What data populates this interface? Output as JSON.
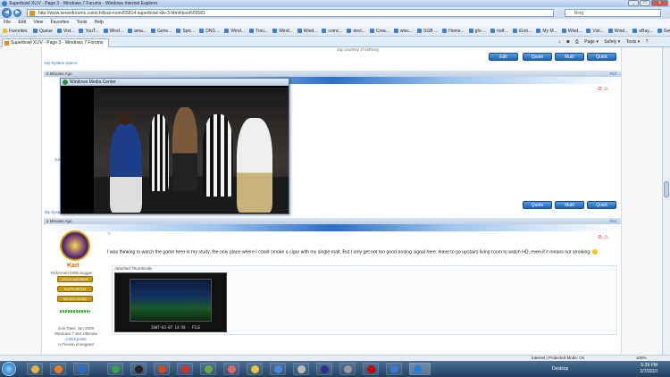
{
  "window": {
    "title": "Superbowl XLIV - Page 3 - Windows 7 Forums - Windows Internet Explorer"
  },
  "address": {
    "url": "http://www.sevenforums.com/chillout-room/55814-superbowl-xliv-3.html#post555581",
    "search_placeholder": "Bing"
  },
  "menu": [
    "File",
    "Edit",
    "View",
    "Favorites",
    "Tools",
    "Help"
  ],
  "favorites": {
    "label": "Favorites",
    "items": [
      "Queue",
      "Vist...",
      "YouT...",
      "Wind...",
      "ama...",
      "Gene...",
      "Spic...",
      "DNS ...",
      "Wind...",
      "Trou...",
      "Wind...",
      "Wind...",
      "comc...",
      "devi...",
      "Crea...",
      "winc...",
      "SGB ...",
      "Home...",
      "gfx-...",
      "netf...",
      "iGoo...",
      "My M...",
      "Wind...",
      "Vist...",
      "Wind...",
      "eBay...",
      "Get ..."
    ]
  },
  "tab": {
    "label": "Superbowl XLIV - Page 3 - Windows 7 Forums"
  },
  "commands": [
    "Page ▾",
    "Safety ▾",
    "Tools ▾"
  ],
  "post_top": {
    "signature": "Sig courtesy of Anthony",
    "specs_link": "My System Specs",
    "buttons": [
      "Edit",
      "Quote",
      "Multi",
      "Quick"
    ]
  },
  "post23": {
    "time": "6 Minutes Ago",
    "number": "#23",
    "buttons": [
      "Quote",
      "Multi",
      "Quick"
    ],
    "sys_specs": "My Syste"
  },
  "wmc": {
    "title": "Windows Media Center"
  },
  "post24": {
    "time": "2 Minutes Ago",
    "number": "#24",
    "user": "Kari",
    "user_title": "Reformed n00b-hugger",
    "badges": [
      "GOLD MEMBER",
      "SUPPORTER",
      "SEVEN GURU"
    ],
    "join": "Join Date: Jan 2009",
    "os": "Windows 7 x64 Ultimate",
    "posts": "2,913 posts",
    "location": "A Finnish immigrant",
    "message": "I was thinking to watch the game here in my study, the only place where I could smoke a cigar with my single malt. But I only get not too good analog signal here. Have to go upstairs living room to watch HD, even if it means not smoking.",
    "attach_label": "Attached Thumbnails",
    "thumb_caption": "2007-03-07 14:58 · FILE"
  },
  "status": {
    "zone": "Internet | Protected Mode: On",
    "zoom": "100%"
  },
  "clock": {
    "time": "5:39 PM",
    "date": "2/7/2010",
    "desktop": "Desktop"
  }
}
